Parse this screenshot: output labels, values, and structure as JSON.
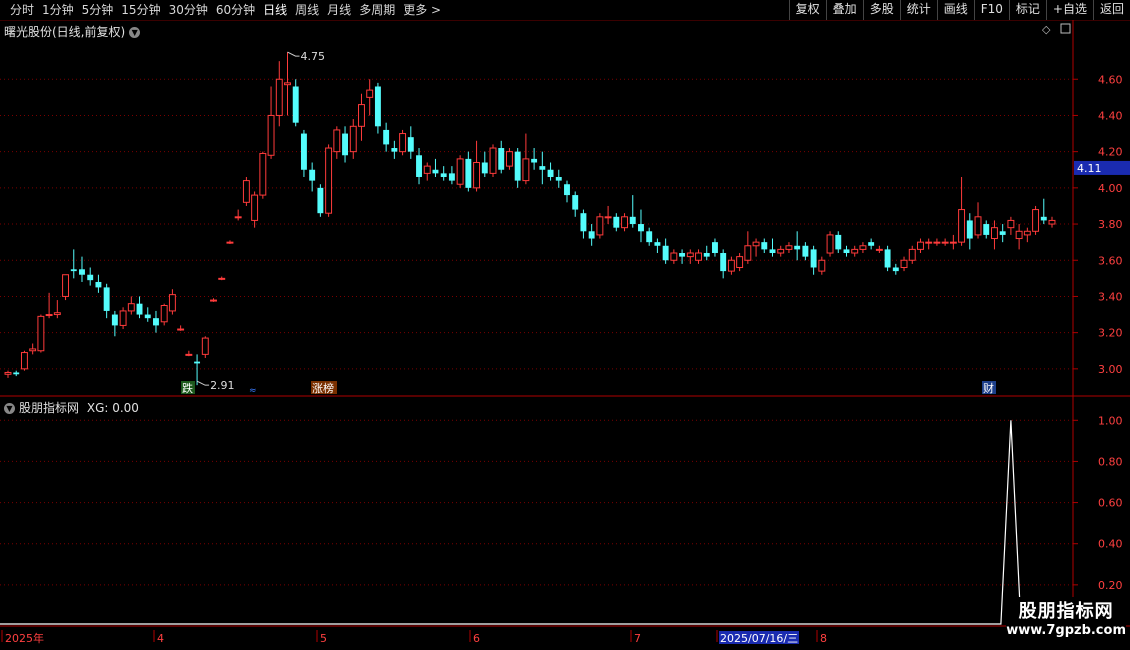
{
  "toolbar": {
    "periods": [
      "分时",
      "1分钟",
      "5分钟",
      "15分钟",
      "30分钟",
      "60分钟",
      "日线",
      "周线",
      "月线",
      "多周期",
      "更多 >"
    ],
    "active": "日线",
    "actions": [
      "复权",
      "叠加",
      "多股",
      "统计",
      "画线",
      "F10",
      "标记",
      "+自选",
      "返回"
    ]
  },
  "main_panel": {
    "title": "曙光股份(日线,前复权)",
    "high_label": "4.75",
    "low_label": "2.91",
    "current_price": "4.11",
    "y_ticks": [
      "4.60",
      "4.40",
      "4.20",
      "4.00",
      "3.80",
      "3.60",
      "3.40",
      "3.20",
      "3.00"
    ],
    "tags": [
      "跌",
      "涨榜",
      "财"
    ]
  },
  "indicator_panel": {
    "title": "股朋指标网",
    "value_label": "XG: 0.00",
    "y_ticks": [
      "1.00",
      "0.80",
      "0.60",
      "0.40",
      "0.20"
    ]
  },
  "date_axis": {
    "labels": [
      "2025年",
      "4",
      "5",
      "6",
      "7",
      "2025/07/16/三",
      "8"
    ]
  },
  "watermark": {
    "line1": "股朋指标网",
    "line2": "www.7gpzb.com"
  },
  "colors": {
    "up": "#ff3b3b",
    "down": "#54fcfc",
    "grid": "#7a0000",
    "axis": "#b00000"
  },
  "chart_data": {
    "type": "candlestick",
    "ylim": [
      2.85,
      4.85
    ],
    "candles": [
      [
        2.97,
        2.99,
        2.95,
        2.98
      ],
      [
        2.98,
        2.99,
        2.96,
        2.97
      ],
      [
        3.0,
        3.1,
        2.99,
        3.09
      ],
      [
        3.1,
        3.14,
        3.08,
        3.11
      ],
      [
        3.1,
        3.3,
        3.09,
        3.29
      ],
      [
        3.3,
        3.42,
        3.28,
        3.3
      ],
      [
        3.3,
        3.38,
        3.28,
        3.31
      ],
      [
        3.4,
        3.52,
        3.38,
        3.52
      ],
      [
        3.55,
        3.66,
        3.5,
        3.54
      ],
      [
        3.55,
        3.62,
        3.48,
        3.52
      ],
      [
        3.52,
        3.56,
        3.46,
        3.49
      ],
      [
        3.48,
        3.52,
        3.42,
        3.45
      ],
      [
        3.45,
        3.47,
        3.28,
        3.32
      ],
      [
        3.3,
        3.32,
        3.18,
        3.24
      ],
      [
        3.24,
        3.34,
        3.22,
        3.32
      ],
      [
        3.32,
        3.4,
        3.3,
        3.36
      ],
      [
        3.36,
        3.4,
        3.28,
        3.3
      ],
      [
        3.3,
        3.34,
        3.26,
        3.28
      ],
      [
        3.28,
        3.32,
        3.2,
        3.24
      ],
      [
        3.26,
        3.36,
        3.24,
        3.35
      ],
      [
        3.32,
        3.44,
        3.3,
        3.41
      ],
      [
        3.22,
        3.24,
        3.21,
        3.22
      ],
      [
        3.08,
        3.1,
        3.07,
        3.08
      ],
      [
        3.04,
        3.08,
        2.91,
        3.03
      ],
      [
        3.08,
        3.18,
        3.06,
        3.17
      ],
      [
        3.38,
        3.39,
        3.37,
        3.38
      ],
      [
        3.5,
        3.51,
        3.49,
        3.5
      ],
      [
        3.7,
        3.71,
        3.69,
        3.7
      ],
      [
        3.84,
        3.88,
        3.82,
        3.84
      ],
      [
        3.92,
        4.06,
        3.9,
        4.04
      ],
      [
        3.82,
        3.98,
        3.78,
        3.96
      ],
      [
        3.96,
        4.2,
        3.94,
        4.19
      ],
      [
        4.18,
        4.56,
        4.16,
        4.4
      ],
      [
        4.4,
        4.7,
        4.34,
        4.6
      ],
      [
        4.57,
        4.75,
        4.4,
        4.58
      ],
      [
        4.56,
        4.6,
        4.34,
        4.36
      ],
      [
        4.3,
        4.32,
        4.06,
        4.1
      ],
      [
        4.1,
        4.14,
        3.98,
        4.04
      ],
      [
        4.0,
        4.02,
        3.84,
        3.86
      ],
      [
        3.86,
        4.24,
        3.84,
        4.22
      ],
      [
        4.2,
        4.34,
        4.16,
        4.32
      ],
      [
        4.3,
        4.34,
        4.14,
        4.18
      ],
      [
        4.2,
        4.38,
        4.16,
        4.34
      ],
      [
        4.34,
        4.52,
        4.26,
        4.46
      ],
      [
        4.5,
        4.6,
        4.4,
        4.54
      ],
      [
        4.56,
        4.58,
        4.3,
        4.34
      ],
      [
        4.32,
        4.36,
        4.2,
        4.24
      ],
      [
        4.22,
        4.26,
        4.16,
        4.2
      ],
      [
        4.2,
        4.32,
        4.18,
        4.3
      ],
      [
        4.28,
        4.34,
        4.16,
        4.2
      ],
      [
        4.18,
        4.22,
        4.02,
        4.06
      ],
      [
        4.08,
        4.14,
        4.04,
        4.12
      ],
      [
        4.1,
        4.16,
        4.06,
        4.08
      ],
      [
        4.08,
        4.12,
        4.04,
        4.06
      ],
      [
        4.08,
        4.12,
        4.02,
        4.04
      ],
      [
        4.02,
        4.18,
        4.0,
        4.16
      ],
      [
        4.16,
        4.2,
        3.98,
        4.0
      ],
      [
        4.0,
        4.26,
        3.98,
        4.14
      ],
      [
        4.14,
        4.2,
        4.06,
        4.08
      ],
      [
        4.08,
        4.24,
        4.06,
        4.22
      ],
      [
        4.22,
        4.26,
        4.08,
        4.1
      ],
      [
        4.12,
        4.22,
        4.1,
        4.2
      ],
      [
        4.2,
        4.22,
        4.0,
        4.04
      ],
      [
        4.04,
        4.3,
        4.02,
        4.16
      ],
      [
        4.16,
        4.22,
        4.1,
        4.14
      ],
      [
        4.12,
        4.2,
        4.02,
        4.1
      ],
      [
        4.1,
        4.14,
        4.04,
        4.06
      ],
      [
        4.06,
        4.1,
        4.0,
        4.04
      ],
      [
        4.02,
        4.04,
        3.92,
        3.96
      ],
      [
        3.96,
        3.98,
        3.84,
        3.88
      ],
      [
        3.86,
        3.88,
        3.72,
        3.76
      ],
      [
        3.76,
        3.8,
        3.68,
        3.72
      ],
      [
        3.74,
        3.86,
        3.72,
        3.84
      ],
      [
        3.84,
        3.9,
        3.8,
        3.84
      ],
      [
        3.84,
        3.86,
        3.76,
        3.78
      ],
      [
        3.78,
        3.86,
        3.76,
        3.84
      ],
      [
        3.84,
        3.96,
        3.78,
        3.8
      ],
      [
        3.8,
        3.88,
        3.7,
        3.76
      ],
      [
        3.76,
        3.78,
        3.68,
        3.7
      ],
      [
        3.7,
        3.72,
        3.64,
        3.68
      ],
      [
        3.68,
        3.72,
        3.58,
        3.6
      ],
      [
        3.6,
        3.66,
        3.58,
        3.64
      ],
      [
        3.64,
        3.66,
        3.58,
        3.62
      ],
      [
        3.62,
        3.66,
        3.58,
        3.64
      ],
      [
        3.6,
        3.66,
        3.58,
        3.64
      ],
      [
        3.64,
        3.68,
        3.6,
        3.62
      ],
      [
        3.7,
        3.72,
        3.62,
        3.64
      ],
      [
        3.64,
        3.66,
        3.5,
        3.54
      ],
      [
        3.54,
        3.62,
        3.52,
        3.6
      ],
      [
        3.56,
        3.64,
        3.54,
        3.62
      ],
      [
        3.6,
        3.76,
        3.58,
        3.68
      ],
      [
        3.68,
        3.72,
        3.62,
        3.7
      ],
      [
        3.7,
        3.72,
        3.64,
        3.66
      ],
      [
        3.66,
        3.72,
        3.62,
        3.64
      ],
      [
        3.64,
        3.68,
        3.62,
        3.66
      ],
      [
        3.66,
        3.7,
        3.64,
        3.68
      ],
      [
        3.68,
        3.76,
        3.6,
        3.66
      ],
      [
        3.68,
        3.7,
        3.6,
        3.62
      ],
      [
        3.66,
        3.68,
        3.52,
        3.56
      ],
      [
        3.54,
        3.62,
        3.52,
        3.6
      ],
      [
        3.64,
        3.76,
        3.62,
        3.74
      ],
      [
        3.74,
        3.76,
        3.64,
        3.66
      ],
      [
        3.66,
        3.68,
        3.62,
        3.64
      ],
      [
        3.64,
        3.68,
        3.62,
        3.66
      ],
      [
        3.66,
        3.7,
        3.64,
        3.68
      ],
      [
        3.7,
        3.72,
        3.66,
        3.68
      ],
      [
        3.66,
        3.68,
        3.64,
        3.66
      ],
      [
        3.66,
        3.68,
        3.54,
        3.56
      ],
      [
        3.56,
        3.58,
        3.52,
        3.54
      ],
      [
        3.56,
        3.62,
        3.54,
        3.6
      ],
      [
        3.6,
        3.68,
        3.58,
        3.66
      ],
      [
        3.66,
        3.72,
        3.64,
        3.7
      ],
      [
        3.7,
        3.72,
        3.66,
        3.7
      ],
      [
        3.7,
        3.72,
        3.68,
        3.7
      ],
      [
        3.7,
        3.72,
        3.68,
        3.7
      ],
      [
        3.7,
        3.74,
        3.66,
        3.7
      ],
      [
        3.7,
        4.06,
        3.68,
        3.88
      ],
      [
        3.82,
        3.86,
        3.66,
        3.72
      ],
      [
        3.74,
        3.92,
        3.72,
        3.84
      ],
      [
        3.8,
        3.82,
        3.72,
        3.74
      ],
      [
        3.72,
        3.82,
        3.66,
        3.78
      ],
      [
        3.76,
        3.8,
        3.7,
        3.74
      ],
      [
        3.78,
        3.84,
        3.74,
        3.82
      ],
      [
        3.72,
        3.8,
        3.66,
        3.76
      ],
      [
        3.74,
        3.78,
        3.7,
        3.76
      ],
      [
        3.76,
        3.9,
        3.74,
        3.88
      ],
      [
        3.84,
        3.94,
        3.8,
        3.82
      ],
      [
        3.8,
        3.84,
        3.78,
        3.82
      ]
    ],
    "indicator": {
      "name": "XG",
      "spike_index": 122,
      "spike_value": 1.0,
      "ylim": [
        0,
        1.05
      ]
    }
  }
}
